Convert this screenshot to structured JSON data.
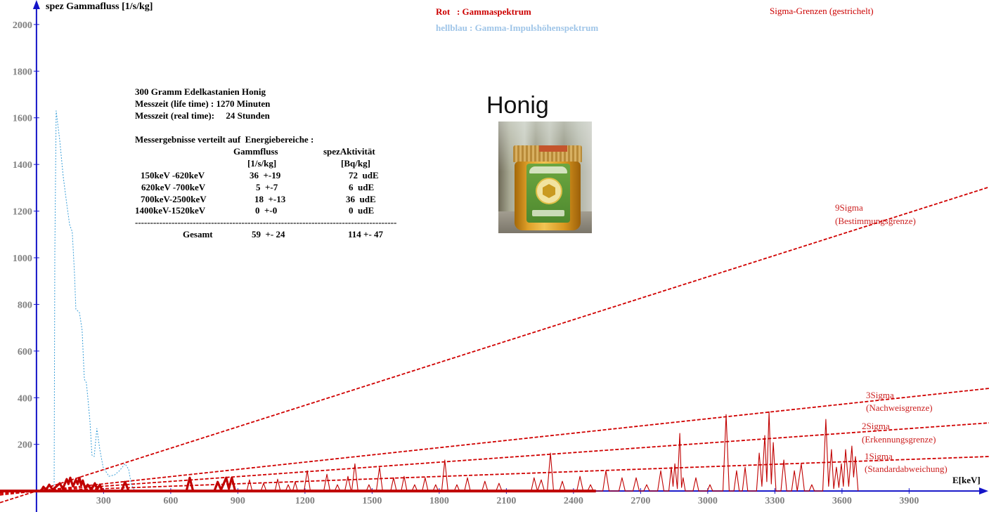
{
  "photo_caption": "Honig",
  "info": {
    "lines": [
      "300 Gramm Edelkastanien Honig",
      "Messzeit (life time) : 1270 Minuten",
      "Messzeit (real time):     24 Stunden"
    ],
    "results_heading": "Messergebnisse verteilt auf  Energiebereiche :",
    "col_flux": "Gammfluss",
    "col_flux_unit": "[1/s/kg]",
    "col_activity": "spezAktivität",
    "col_activity_unit": "[Bq/kg]",
    "rows": [
      {
        "range": "150keV -620keV",
        "flux": "36  +-19",
        "activity": "72  udE"
      },
      {
        "range": "620keV -700keV",
        "flux": "5  +-7",
        "activity": "6  udE"
      },
      {
        "range": "700keV-2500keV",
        "flux": "18  +-13",
        "activity": "36  udE"
      },
      {
        "range": "1400keV-1520keV",
        "flux": "0  +-0",
        "activity": "0  udE"
      }
    ],
    "separator": "--------------------------------------------------------------------------------------",
    "total": {
      "label": "Gesamt",
      "flux": "59  +- 24",
      "activity": "114 +- 47"
    }
  },
  "colors": {
    "axis": "#1414c8",
    "tick_label": "#808080"
  },
  "chart_data": {
    "type": "line",
    "title": "",
    "xlabel": "E[keV]",
    "ylabel": "spez Gammafluss [1/s/kg]",
    "xlim": [
      -163,
      4257
    ],
    "ylim": [
      -90,
      2105
    ],
    "x_ticks": [
      300,
      600,
      900,
      1200,
      1500,
      1800,
      2100,
      2400,
      2700,
      3000,
      3300,
      3600,
      3900
    ],
    "y_ticks": [
      200,
      400,
      600,
      800,
      1000,
      1200,
      1400,
      1600,
      1800,
      2000
    ],
    "grid": false,
    "legend_position": "top",
    "legend": [
      {
        "text": "Rot   : Gammaspektrum",
        "color": "#cc0000"
      },
      {
        "text": "hellblau : Gamma-Impulshöhenspektrum",
        "color": "#9fc5e8"
      },
      {
        "text": "Sigma-Grenzen (gestrichelt)",
        "color": "#cc0000"
      }
    ],
    "series": [
      {
        "name": "Gammaspektrum",
        "color": "#c00000",
        "style": "solid",
        "x": [
          0,
          20,
          31,
          42,
          57,
          72,
          90,
          104,
          118,
          135,
          143,
          151,
          163,
          176,
          184,
          192,
          200,
          207,
          218,
          229,
          245,
          261,
          272,
          283,
          295,
          380,
          396,
          412,
          670,
          685,
          700,
          795,
          810,
          825,
          848,
          860,
          873,
          888,
          940,
          952,
          964,
          1003,
          1015,
          1027,
          1066,
          1078,
          1090,
          1113,
          1125,
          1137,
          1145,
          1156,
          1167,
          1196,
          1210,
          1224,
          1284,
          1298,
          1312,
          1333,
          1345,
          1357,
          1378,
          1392,
          1406,
          1409,
          1423,
          1437,
          1474,
          1486,
          1498,
          1519,
          1533,
          1547,
          1583,
          1596,
          1609,
          1630,
          1643,
          1656,
          1678,
          1690,
          1702,
          1724,
          1737,
          1750,
          1772,
          1784,
          1796,
          1811,
          1825,
          1839,
          1867,
          1879,
          1891,
          1913,
          1926,
          1939,
          1991,
          2004,
          2017,
          2054,
          2067,
          2080,
          2211,
          2224,
          2239,
          2256,
          2270,
          2283,
          2297,
          2311,
          2337,
          2350,
          2363,
          2415,
          2429,
          2443,
          2463,
          2476,
          2489,
          2531,
          2545,
          2559,
          2603,
          2617,
          2631,
          2666,
          2680,
          2694,
          2714,
          2727,
          2740,
          2776,
          2790,
          2804,
          2826,
          2837,
          2845,
          2853,
          2864,
          2875,
          2883,
          2890,
          2900,
          2934,
          2947,
          2960,
          2998,
          3010,
          3022,
          3068,
          3082,
          3096,
          3117,
          3129,
          3141,
          3155,
          3167,
          3179,
          3218,
          3230,
          3242,
          3255,
          3264,
          3274,
          3284,
          3293,
          3305,
          3327,
          3340,
          3353,
          3375,
          3387,
          3400,
          3418,
          3432,
          3453,
          3465,
          3477,
          3514,
          3528,
          3540,
          3553,
          3563,
          3575,
          3586,
          3597,
          3606,
          3616,
          3630,
          3644,
          3652,
          3660,
          3672
        ],
        "y": [
          0,
          0,
          18,
          4,
          27,
          6,
          20,
          33,
          10,
          51,
          30,
          57,
          20,
          48,
          30,
          57,
          25,
          45,
          10,
          27,
          5,
          33,
          8,
          27,
          0,
          0,
          39,
          0,
          0,
          57,
          0,
          0,
          39,
          5,
          57,
          10,
          57,
          0,
          0,
          48,
          0,
          0,
          33,
          0,
          0,
          51,
          0,
          0,
          27,
          0,
          0,
          39,
          0,
          0,
          87,
          0,
          0,
          72,
          0,
          0,
          27,
          0,
          0,
          63,
          0,
          0,
          117,
          0,
          0,
          27,
          0,
          0,
          102,
          0,
          0,
          57,
          0,
          0,
          63,
          0,
          0,
          27,
          0,
          0,
          57,
          0,
          0,
          27,
          0,
          0,
          133,
          0,
          0,
          27,
          0,
          0,
          57,
          0,
          0,
          42,
          0,
          0,
          33,
          0,
          0,
          57,
          0,
          48,
          0,
          0,
          163,
          0,
          0,
          42,
          0,
          0,
          63,
          0,
          0,
          27,
          0,
          0,
          87,
          0,
          0,
          57,
          0,
          0,
          57,
          0,
          0,
          27,
          0,
          0,
          87,
          0,
          0,
          102,
          20,
          117,
          10,
          247,
          15,
          57,
          0,
          0,
          57,
          0,
          0,
          27,
          0,
          0,
          328,
          0,
          0,
          87,
          0,
          0,
          102,
          0,
          0,
          163,
          20,
          238,
          40,
          340,
          30,
          208,
          0,
          0,
          133,
          0,
          0,
          87,
          0,
          117,
          0,
          0,
          27,
          0,
          0,
          307,
          20,
          178,
          10,
          102,
          15,
          117,
          20,
          178,
          20,
          193,
          60,
          148,
          0
        ]
      },
      {
        "name": "Gamma-Impulshöhenspektrum",
        "color": "#3a9fd8",
        "style": "dashed",
        "x": [
          79,
          82,
          88,
          104,
          119,
          135,
          148,
          160,
          170,
          176,
          192,
          204,
          214,
          223,
          229,
          239,
          248,
          258,
          270,
          283,
          298,
          324,
          349,
          371,
          396,
          412,
          424,
          440
        ],
        "y": [
          0,
          1021,
          1630,
          1503,
          1352,
          1232,
          1142,
          1111,
          931,
          780,
          765,
          690,
          479,
          464,
          404,
          298,
          154,
          148,
          268,
          178,
          102,
          63,
          69,
          87,
          117,
          93,
          27,
          0
        ]
      },
      {
        "name": "9Sigma",
        "color": "#d00000",
        "style": "dashed",
        "x": [
          -163,
          4257
        ],
        "y": [
          -50,
          1303
        ]
      },
      {
        "name": "3Sigma",
        "color": "#d00000",
        "style": "dashed",
        "x": [
          -163,
          4257
        ],
        "y": [
          -17,
          440
        ]
      },
      {
        "name": "2Sigma",
        "color": "#d00000",
        "style": "dashed",
        "x": [
          -163,
          4257
        ],
        "y": [
          -11,
          292
        ]
      },
      {
        "name": "1Sigma",
        "color": "#d00000",
        "style": "dashed",
        "x": [
          -163,
          4257
        ],
        "y": [
          -6,
          148
        ]
      }
    ],
    "annotations": [
      {
        "text": "9Sigma"
      },
      {
        "text": "(Bestimmungsgrenze)"
      },
      {
        "text": "3Sigma"
      },
      {
        "text": "(Nachweisgrenze)"
      },
      {
        "text": "2Sigma"
      },
      {
        "text": "(Erkennungsgrenze)"
      },
      {
        "text": "1Sigma"
      },
      {
        "text": "(Standardabweichung)"
      }
    ]
  }
}
